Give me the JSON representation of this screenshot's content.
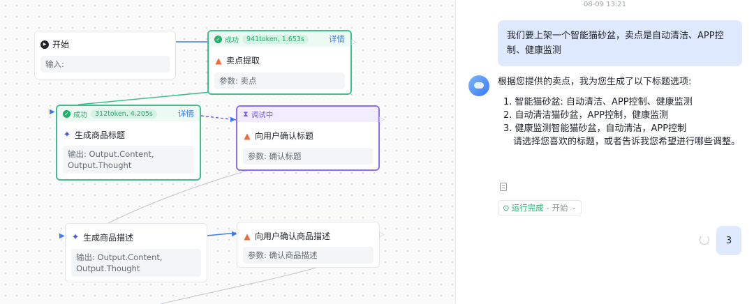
{
  "nodes": {
    "start": {
      "title": "开始",
      "field": "输入:"
    },
    "selling_points": {
      "status": "成功",
      "tokens": "941token, 1.653s",
      "detail": "详情",
      "title": "卖点提取",
      "param": "参数: 卖点"
    },
    "gen_title": {
      "status": "成功",
      "tokens": "312token, 4.205s",
      "detail": "详情",
      "title": "生成商品标题",
      "output": "输出: Output.Content, Output.Thought"
    },
    "confirm_title": {
      "status": "调试中",
      "title": "向用户确认标题",
      "param": "参数: 确认标题"
    },
    "gen_desc": {
      "title": "生成商品描述",
      "output": "输出: Output.Content, Output.Thought"
    },
    "confirm_desc": {
      "title": "向用户确认商品描述",
      "param": "参数: 确认商品描述"
    }
  },
  "chat": {
    "timestamp": "08-09 13:21",
    "user_message": "我们要上架一个智能猫砂盆，卖点是自动清洁、APP控制、健康监测",
    "bot_lead": "根据您提供的卖点，我为您生成了以下标题选项:",
    "bot_options": [
      "1. 智能猫砂盆: 自动清洁、APP控制、健康监测",
      "2. 自动清洁猫砂盆，APP控制，健康监测",
      "3. 健康监测智能猫砂盆，自动清洁，APP控制"
    ],
    "bot_tail": "请选择您喜欢的标题，或者告诉我您希望进行哪些调整。",
    "run_status": "运行完成",
    "run_from": "- 开始",
    "user_reply": "3"
  },
  "colors": {
    "success": "#1fb36a",
    "running": "#7a5bf0",
    "accent": "#3d7bf5",
    "user_bubble": "#dfe9ff"
  }
}
